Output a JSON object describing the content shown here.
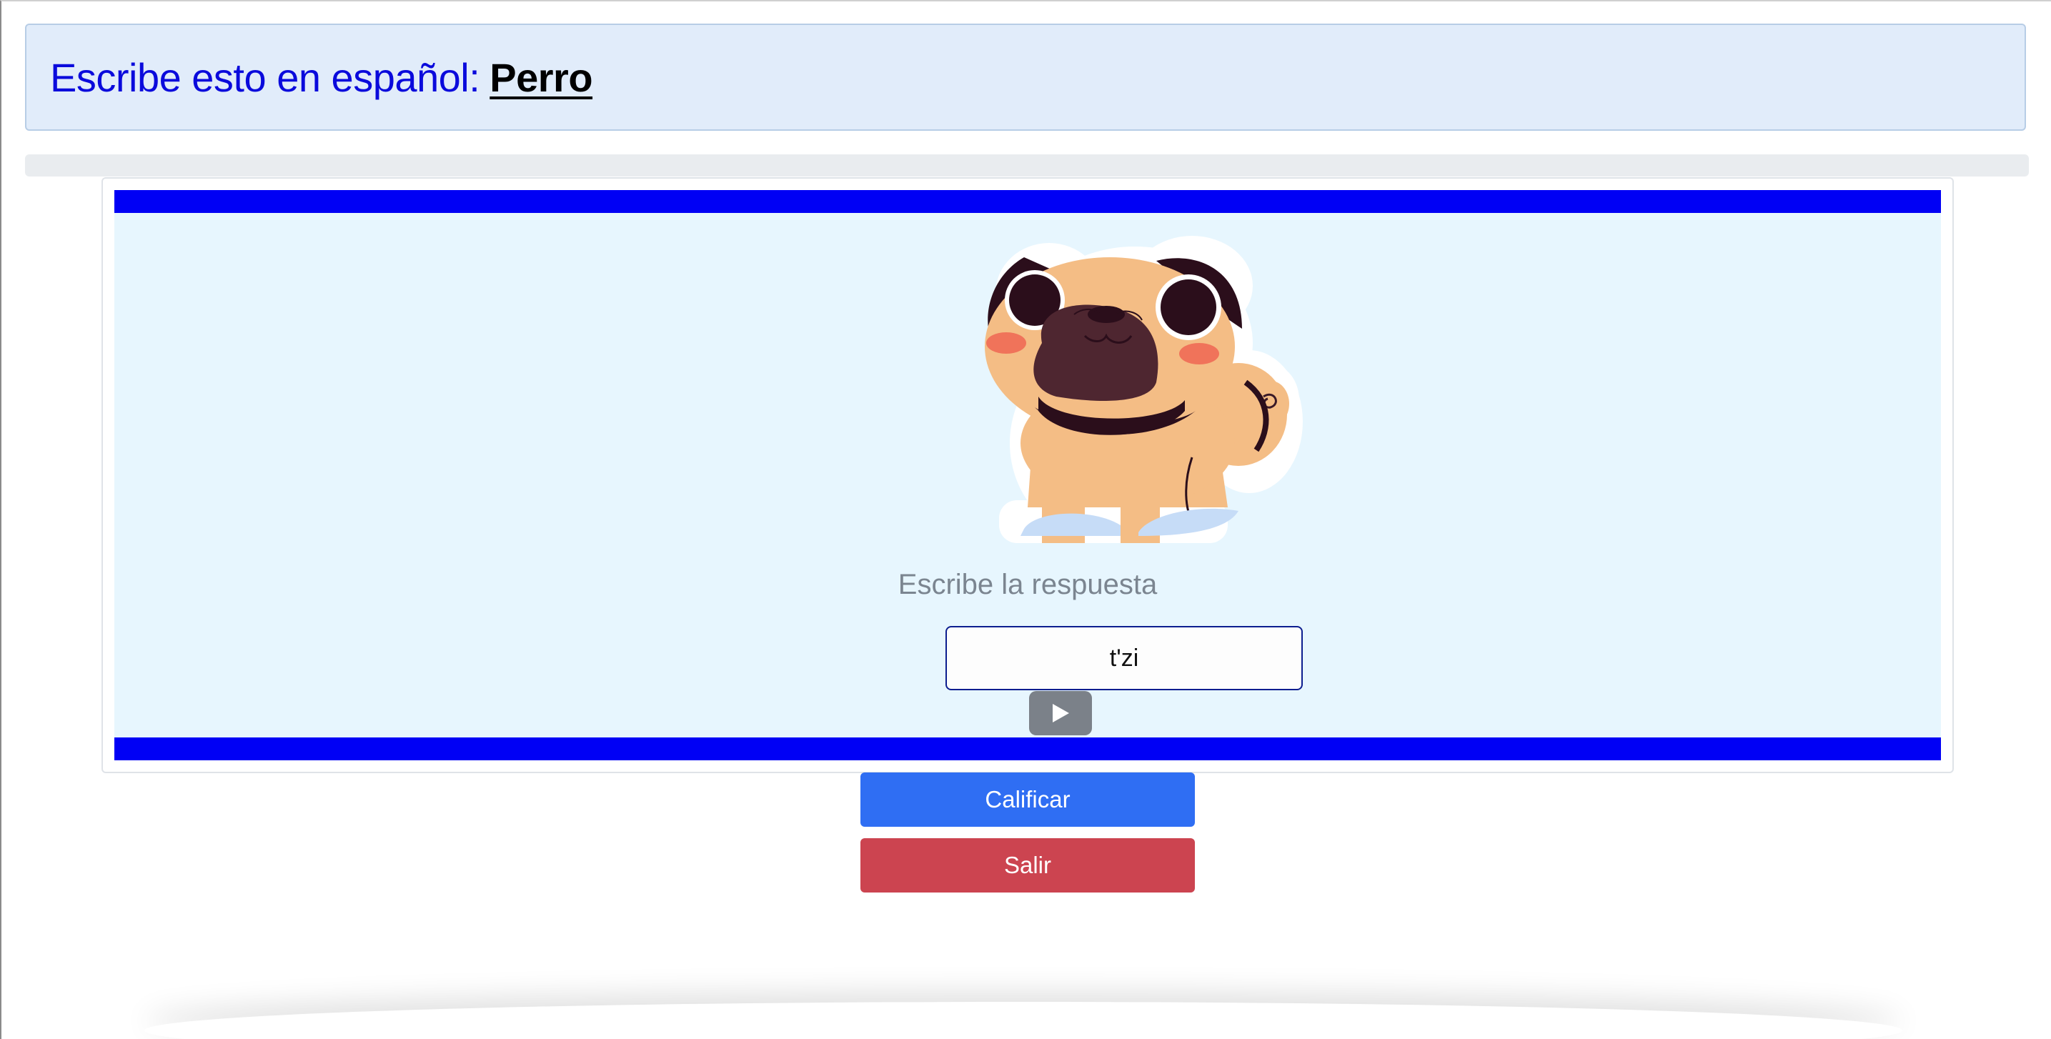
{
  "header": {
    "prompt": "Escribe esto en español:",
    "word": "Perro"
  },
  "progress": {
    "fraction": 0.0
  },
  "exercise": {
    "image_alt": "pug-dog-illustration",
    "answer_label": "Escribe la respuesta",
    "answer_value": "t'zi",
    "play_icon": "play-icon"
  },
  "actions": {
    "grade_label": "Calificar",
    "exit_label": "Salir"
  },
  "colors": {
    "prompt_text": "#0a0adc",
    "band": "#0000f5",
    "grade_button": "#2f6ef3",
    "exit_button": "#cc4450"
  }
}
